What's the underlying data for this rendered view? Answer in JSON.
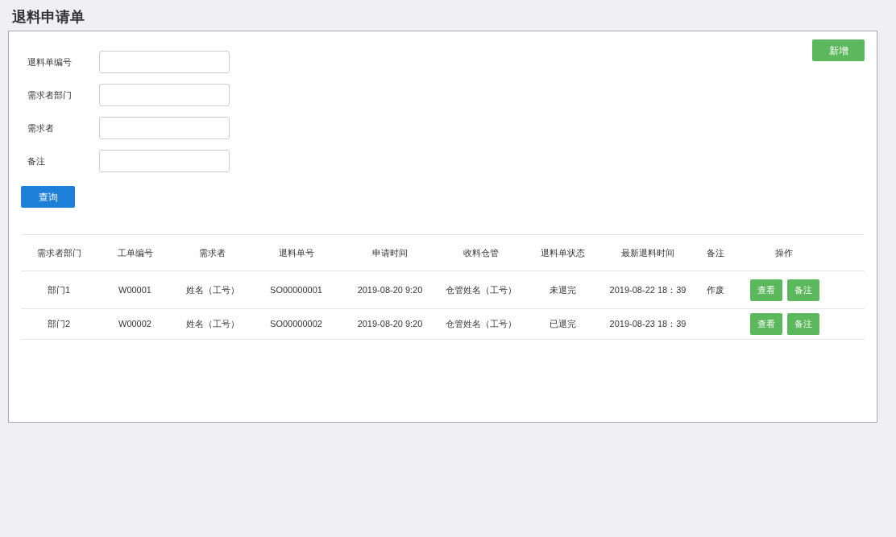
{
  "page_title": "退料申请单",
  "add_button": "新增",
  "filters": [
    {
      "label": "退料单编号"
    },
    {
      "label": "需求者部门"
    },
    {
      "label": "需求者"
    },
    {
      "label": "备注"
    }
  ],
  "query_button": "查询",
  "table": {
    "columns": [
      "需求者部门",
      "工单编号",
      "需求者",
      "退料单号",
      "申请时间",
      "收料仓管",
      "退料单状态",
      "最新退料时间",
      "备注",
      "操作"
    ],
    "rows": [
      {
        "cells": [
          "部门1",
          "W00001",
          "姓名（工号）",
          "SO00000001",
          "2019-08-20 9:20",
          "仓管姓名（工号）",
          "未退完",
          "2019-08-22 18：39",
          "作废"
        ],
        "actions": [
          "查看",
          "备注"
        ]
      },
      {
        "cells": [
          "部门2",
          "W00002",
          "姓名（工号）",
          "SO00000002",
          "2019-08-20 9:20",
          "仓管姓名（工号）",
          "已退完",
          "2019-08-23 18：39"
        ],
        "actions": [
          "查看",
          "备注"
        ]
      }
    ]
  }
}
